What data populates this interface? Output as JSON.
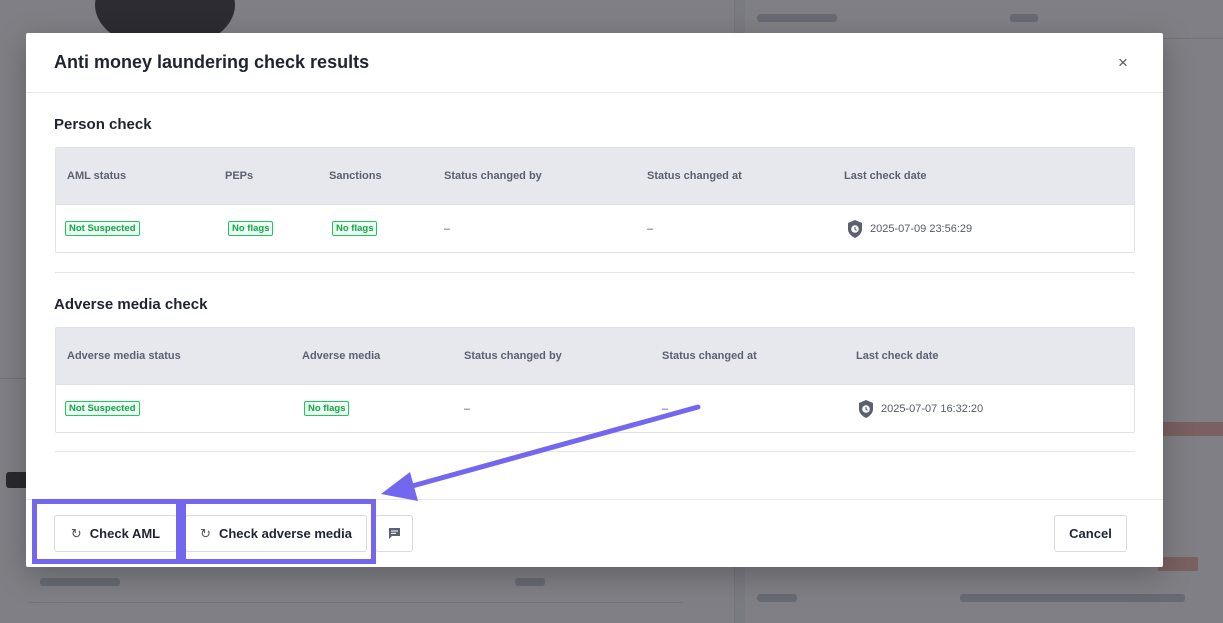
{
  "modal": {
    "title": "Anti money laundering check results",
    "close_icon": "×"
  },
  "person_check": {
    "title": "Person check",
    "columns": [
      "AML status",
      "PEPs",
      "Sanctions",
      "Status changed by",
      "Status changed at",
      "Last check date"
    ],
    "row": {
      "aml_status": "Not Suspected",
      "peps": "No flags",
      "sanctions": "No flags",
      "status_changed_by": "–",
      "status_changed_at": "–",
      "last_check_date": "2025-07-09 23:56:29"
    }
  },
  "adverse_media_check": {
    "title": "Adverse media check",
    "columns": [
      "Adverse media status",
      "Adverse media",
      "Status changed by",
      "Status changed at",
      "Last check date"
    ],
    "row": {
      "adverse_media_status": "Not Suspected",
      "adverse_media": "No flags",
      "status_changed_by": "–",
      "status_changed_at": "–",
      "last_check_date": "2025-07-07 16:32:20"
    }
  },
  "footer": {
    "check_aml_label": "Check AML",
    "check_adverse_media_label": "Check adverse media",
    "cancel_label": "Cancel",
    "refresh_icon": "↻",
    "comment_icon": "comment-icon"
  },
  "colors": {
    "accent_highlight": "#7367f0",
    "status_green": "#16a34a",
    "header_bg": "#e6e8ee"
  }
}
